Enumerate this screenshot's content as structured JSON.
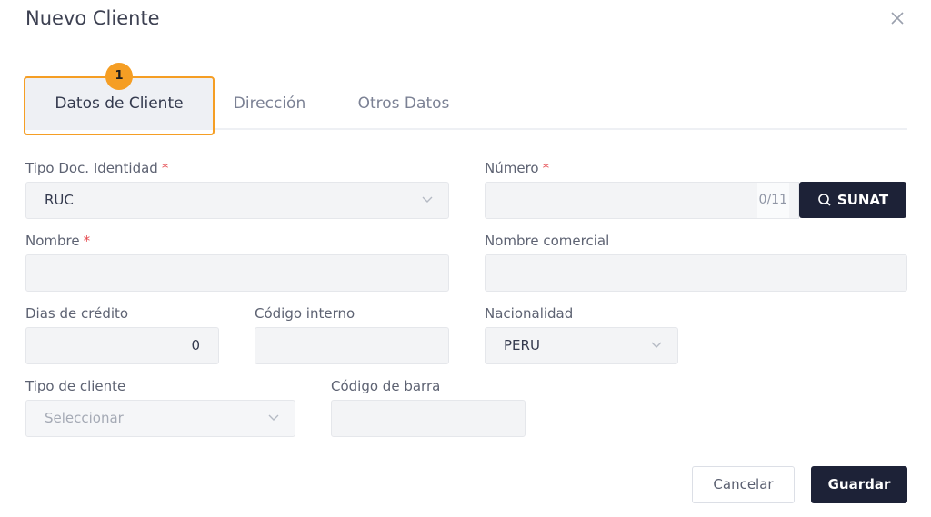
{
  "dialog": {
    "title": "Nuevo Cliente"
  },
  "tabs": [
    {
      "label": "Datos de Cliente",
      "active": true
    },
    {
      "label": "Dirección",
      "active": false
    },
    {
      "label": "Otros Datos",
      "active": false
    }
  ],
  "step_badge": "1",
  "form": {
    "tipo_doc": {
      "label": "Tipo Doc. Identidad",
      "required_mark": "*",
      "value": "RUC"
    },
    "numero": {
      "label": "Número",
      "required_mark": "*",
      "value": "",
      "counter": "0/11"
    },
    "sunat_button": "SUNAT",
    "nombre": {
      "label": "Nombre",
      "required_mark": "*",
      "value": ""
    },
    "nombre_comercial": {
      "label": "Nombre comercial",
      "value": ""
    },
    "dias_credito": {
      "label": "Dias de crédito",
      "value": "0"
    },
    "codigo_interno": {
      "label": "Código interno",
      "value": ""
    },
    "nacionalidad": {
      "label": "Nacionalidad",
      "value": "PERU"
    },
    "tipo_cliente": {
      "label": "Tipo de cliente",
      "placeholder": "Seleccionar"
    },
    "codigo_barra": {
      "label": "Código de barra",
      "value": ""
    }
  },
  "footer": {
    "cancel": "Cancelar",
    "save": "Guardar"
  },
  "colors": {
    "accent_highlight": "#f59e24",
    "primary_button": "#1d2237",
    "required": "#e5484d"
  }
}
